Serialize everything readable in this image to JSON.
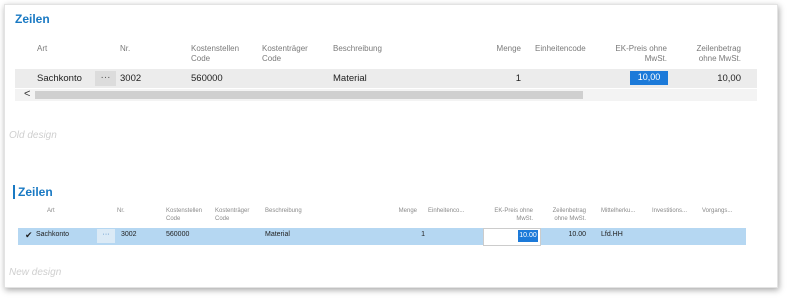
{
  "old": {
    "title": "Zeilen",
    "headers": {
      "art": "Art",
      "nr": "Nr.",
      "kostenstellen": "Kostenstellen Code",
      "kostentraeger": "Kostenträger Code",
      "beschreibung": "Beschreibung",
      "menge": "Menge",
      "einheitencode": "Einheitencode",
      "ek_preis": "EK-Preis ohne MwSt.",
      "zeilenbetrag": "Zeilenbetrag ohne MwSt."
    },
    "row": {
      "art": "Sachkonto",
      "dots": "···",
      "nr": "3002",
      "kostenstellen": "560000",
      "beschreibung": "Material",
      "menge": "1",
      "ek_preis": "10,00",
      "zeilenbetrag": "10,00"
    },
    "scroll_left": "<",
    "caption": "Old design"
  },
  "new": {
    "title": "Zeilen",
    "headers": {
      "art": "Art",
      "nr": "Nr.",
      "kostenstellen": "Kostenstellen Code",
      "kostentraeger": "Kostenträger Code",
      "beschreibung": "Beschreibung",
      "menge": "Menge",
      "einheitencode": "Einheitenco...",
      "ek_preis": "EK-Preis ohne MwSt.",
      "zeilenbetrag": "Zeilenbetrag ohne MwSt.",
      "mittelherkunft": "Mittelherku...",
      "investitions": "Investitions...",
      "vorgangs": "Vorgangs..."
    },
    "row": {
      "art": "Sachkonto",
      "dots": "···",
      "nr": "3002",
      "kostenstellen": "560000",
      "beschreibung": "Material",
      "menge": "1",
      "ek_preis": "10.00",
      "zeilenbetrag": "10.00",
      "mittelherkunft": "Lfd.HH"
    },
    "caption": "New design"
  },
  "colors": {
    "accent": "#1979c3",
    "selection": "#1c7ad9",
    "row_new": "#b5d7f2",
    "row_old": "#ececec"
  }
}
